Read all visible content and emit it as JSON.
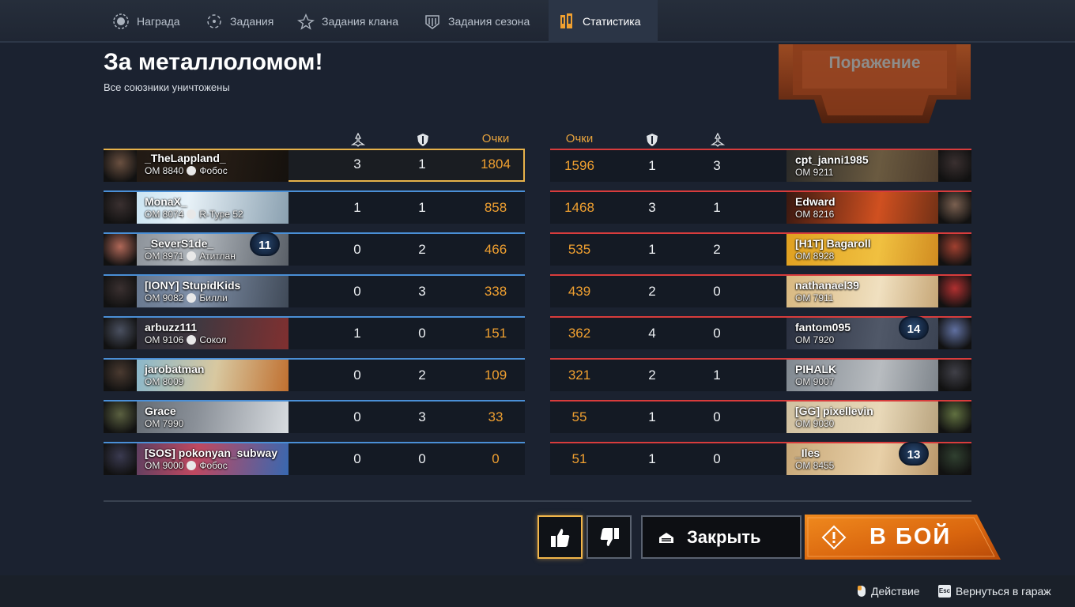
{
  "tabs": [
    {
      "label": "Награда",
      "icon": "medal-icon"
    },
    {
      "label": "Задания",
      "icon": "tasks-icon"
    },
    {
      "label": "Задания клана",
      "icon": "clan-tasks-icon"
    },
    {
      "label": "Задания сезона",
      "icon": "season-tasks-icon"
    },
    {
      "label": "Статистика",
      "icon": "stats-icon"
    }
  ],
  "header": {
    "title": "За металлоломом!",
    "subtitle": "Все союзники уничтожены",
    "result": "Поражение"
  },
  "columns": {
    "score_label": "Очки",
    "kills_icon": "kills-icon",
    "assists_icon": "shield-icon"
  },
  "allies": [
    {
      "name": "_TheLappland_",
      "rating": "ОМ 8840",
      "clan": "Фобос",
      "level": "",
      "kills": "3",
      "assists": "1",
      "score": "1804"
    },
    {
      "name": "MonaX_",
      "rating": "ОМ 8074",
      "clan": "R-Type 52",
      "level": "",
      "kills": "1",
      "assists": "1",
      "score": "858"
    },
    {
      "name": "_SeverS1de_",
      "rating": "ОМ 8971",
      "clan": "Атитлан",
      "level": "11",
      "kills": "0",
      "assists": "2",
      "score": "466"
    },
    {
      "name": "[IONY] StupidKids",
      "rating": "ОМ 9082",
      "clan": "Билли",
      "level": "",
      "kills": "0",
      "assists": "3",
      "score": "338"
    },
    {
      "name": "arbuzz111",
      "rating": "ОМ 9106",
      "clan": "Сокол",
      "level": "",
      "kills": "1",
      "assists": "0",
      "score": "151"
    },
    {
      "name": "jarobatman",
      "rating": "ОМ 8009",
      "clan": "",
      "level": "",
      "kills": "0",
      "assists": "2",
      "score": "109"
    },
    {
      "name": "Grace",
      "rating": "ОМ 7990",
      "clan": "",
      "level": "",
      "kills": "0",
      "assists": "3",
      "score": "33"
    },
    {
      "name": "[SOS] pokonyan_subway",
      "rating": "ОМ 9000",
      "clan": "Фобос",
      "level": "",
      "kills": "0",
      "assists": "0",
      "score": "0"
    }
  ],
  "enemies": [
    {
      "name": "cpt_janni1985",
      "rating": "ОМ 9211",
      "level": "",
      "score": "1596",
      "assists": "1",
      "kills": "3"
    },
    {
      "name": "Edward",
      "rating": "ОМ 8216",
      "level": "",
      "score": "1468",
      "assists": "3",
      "kills": "1"
    },
    {
      "name": "[H1T] Bagaroll",
      "rating": "ОМ 8928",
      "level": "",
      "score": "535",
      "assists": "1",
      "kills": "2"
    },
    {
      "name": "nathanael39",
      "rating": "ОМ 7911",
      "level": "",
      "score": "439",
      "assists": "2",
      "kills": "0"
    },
    {
      "name": "fantom095",
      "rating": "ОМ 7920",
      "level": "14",
      "score": "362",
      "assists": "4",
      "kills": "0"
    },
    {
      "name": "PIHALK",
      "rating": "ОМ 9007",
      "level": "",
      "score": "321",
      "assists": "2",
      "kills": "1"
    },
    {
      "name": "[GG] pixellevin",
      "rating": "ОМ 9030",
      "level": "",
      "score": "55",
      "assists": "1",
      "kills": "0"
    },
    {
      "name": "_Iles",
      "rating": "ОМ 8455",
      "level": "13",
      "score": "51",
      "assists": "1",
      "kills": "0"
    }
  ],
  "buttons": {
    "close": "Закрыть",
    "fight": "В БОЙ"
  },
  "footer": {
    "action": "Действие",
    "back": "Вернуться в гараж",
    "esc_key": "Esc"
  },
  "colors": {
    "accent_orange": "#f0a030",
    "ally_blue": "#4a8fd6",
    "enemy_red": "#d83c3c",
    "highlight_gold": "#e7b24a"
  }
}
